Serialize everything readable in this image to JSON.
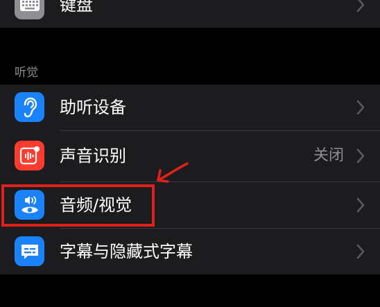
{
  "keyboard_row": {
    "label": "键盘"
  },
  "hearing_section": {
    "header": "听觉",
    "items": [
      {
        "label": "助听设备",
        "icon": "ear-icon",
        "icon_color": "#1a82fb"
      },
      {
        "label": "声音识别",
        "value": "关闭",
        "icon": "sound-recognition-icon",
        "icon_color": "#ff3b30"
      },
      {
        "label": "音频/视觉",
        "icon": "audio-visual-icon",
        "icon_color": "#1a82fb"
      },
      {
        "label": "字幕与隐藏式字幕",
        "icon": "subtitles-icon",
        "icon_color": "#1a82fb"
      }
    ]
  },
  "colors": {
    "highlight": "#e0201b",
    "chevron": "#5a5a5e"
  }
}
